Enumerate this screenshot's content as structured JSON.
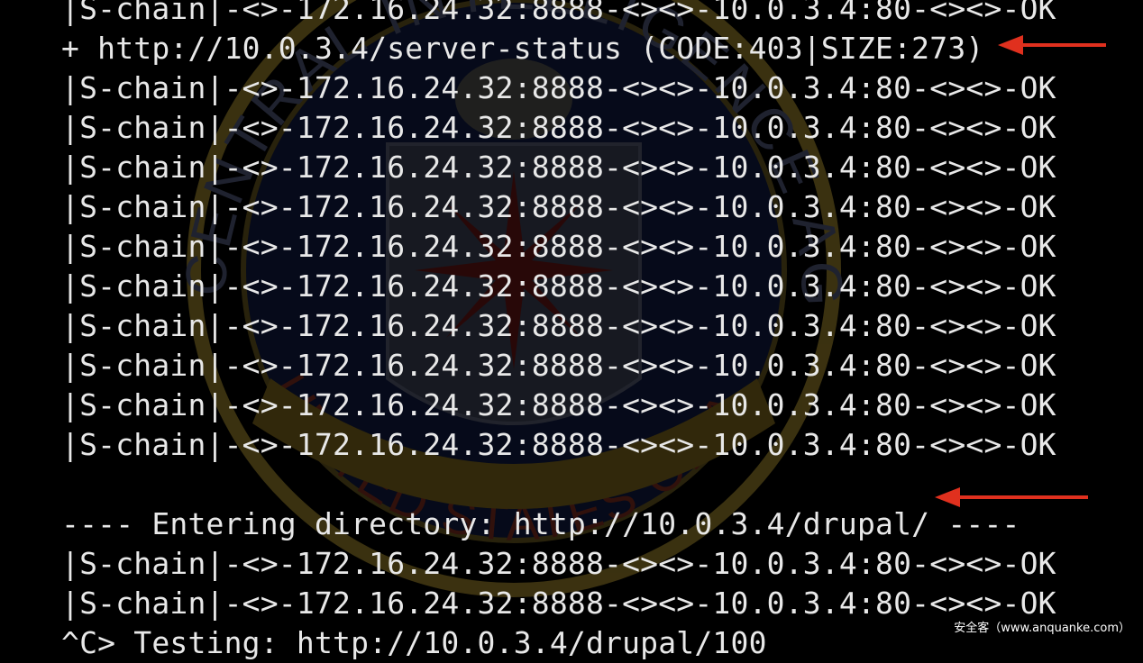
{
  "terminal": {
    "lines": [
      "|S-chain|-<>-172.16.24.32:8888-<><>-10.0.3.4:80-<><>-OK",
      "+ http://10.0.3.4/server-status (CODE:403|SIZE:273)",
      "|S-chain|-<>-172.16.24.32:8888-<><>-10.0.3.4:80-<><>-OK",
      "|S-chain|-<>-172.16.24.32:8888-<><>-10.0.3.4:80-<><>-OK",
      "|S-chain|-<>-172.16.24.32:8888-<><>-10.0.3.4:80-<><>-OK",
      "|S-chain|-<>-172.16.24.32:8888-<><>-10.0.3.4:80-<><>-OK",
      "|S-chain|-<>-172.16.24.32:8888-<><>-10.0.3.4:80-<><>-OK",
      "|S-chain|-<>-172.16.24.32:8888-<><>-10.0.3.4:80-<><>-OK",
      "|S-chain|-<>-172.16.24.32:8888-<><>-10.0.3.4:80-<><>-OK",
      "|S-chain|-<>-172.16.24.32:8888-<><>-10.0.3.4:80-<><>-OK",
      "|S-chain|-<>-172.16.24.32:8888-<><>-10.0.3.4:80-<><>-OK",
      "|S-chain|-<>-172.16.24.32:8888-<><>-10.0.3.4:80-<><>-OK",
      "",
      "---- Entering directory: http://10.0.3.4/drupal/ ----",
      "|S-chain|-<>-172.16.24.32:8888-<><>-10.0.3.4:80-<><>-OK",
      "|S-chain|-<>-172.16.24.32:8888-<><>-10.0.3.4:80-<><>-OK",
      "^C> Testing: http://10.0.3.4/drupal/100"
    ]
  },
  "watermark": {
    "seal_text_top": "CENTRAL INTELLIGENCE AGENCY",
    "seal_text_bottom": "UNITED STATES OF AMERICA"
  },
  "annotations": {
    "arrow_color": "#e0301e",
    "arrows": [
      "arrow-pointing-server-status",
      "arrow-pointing-drupal-directory"
    ]
  },
  "credit": "安全客（www.anquanke.com）",
  "colors": {
    "background": "#000000",
    "text": "#e8e8e8"
  }
}
